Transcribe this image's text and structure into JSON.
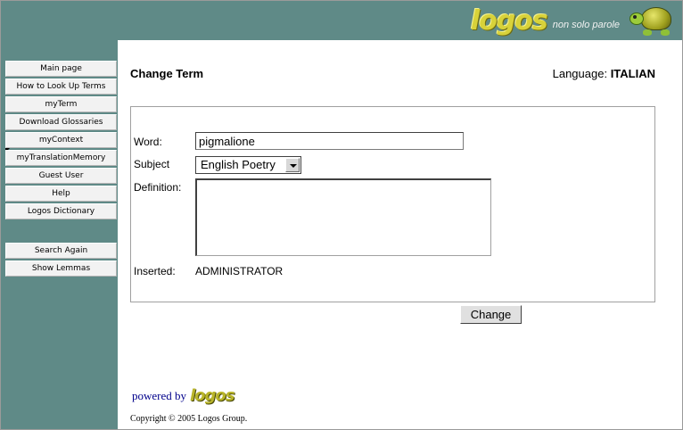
{
  "header": {
    "logo_text": "logos",
    "slogan": "non solo parole"
  },
  "sidebar": {
    "items": [
      {
        "label": "Main page"
      },
      {
        "label": "How to Look Up Terms"
      },
      {
        "label": "myTerm"
      },
      {
        "label": "Download Glossaries"
      },
      {
        "label": "myContext"
      },
      {
        "label": "myTranslationMemory"
      },
      {
        "label": "Guest User"
      },
      {
        "label": "Help"
      },
      {
        "label": "Logos Dictionary"
      }
    ],
    "actions": [
      {
        "label": "Search Again"
      },
      {
        "label": "Show Lemmas"
      }
    ],
    "active_item": "myTerm"
  },
  "main": {
    "title": "Change Term",
    "language_label": "Language:",
    "language_value": "ITALIAN",
    "form": {
      "word_label": "Word:",
      "word_value": "pigmalione",
      "subject_label": "Subject",
      "subject_value": "English Poetry",
      "definition_label": "Definition:",
      "definition_value": "",
      "inserted_label": "Inserted:",
      "inserted_value": "ADMINISTRATOR"
    },
    "change_button": "Change"
  },
  "footer": {
    "powered_by": "powered by",
    "powered_logo": "logos",
    "copyright": "Copyright © 2005 Logos Group."
  },
  "colors": {
    "teal_background": "#5f8a87",
    "logo_yellow": "#d8d23a",
    "powered_blue": "#00008b"
  }
}
